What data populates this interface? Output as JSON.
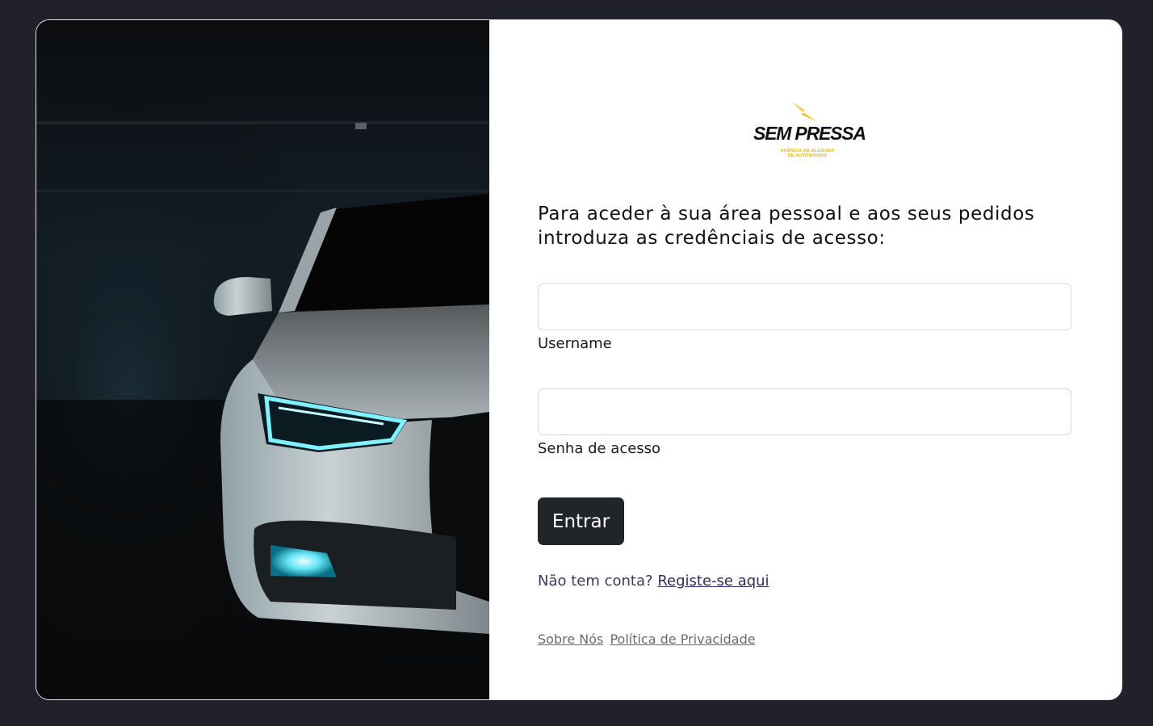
{
  "brand": {
    "name": "SEM PRESSA",
    "tagline_line1": "AGÊNCIA DE ALUGUER",
    "tagline_line2": "DE AUTOMÓVEIS",
    "accent_color": "#f2c320"
  },
  "hero": {
    "image": "car-headlight-photo"
  },
  "login": {
    "intro_line1": "Para aceder à sua área pessoal e aos seus pedidos",
    "intro_line2": "introduza as credênciais de acesso:",
    "username_label": "Username",
    "username_value": "",
    "password_label": "Senha de acesso",
    "password_value": "",
    "submit_label": "Entrar"
  },
  "register": {
    "prompt": "Não tem conta?",
    "link_label": "Registe-se aqui"
  },
  "footer": {
    "about_label": "Sobre Nós",
    "privacy_label": "Política de Privacidade"
  },
  "colors": {
    "page_bg": "#21212c",
    "button_bg": "#212529",
    "card_bg": "#ffffff"
  }
}
